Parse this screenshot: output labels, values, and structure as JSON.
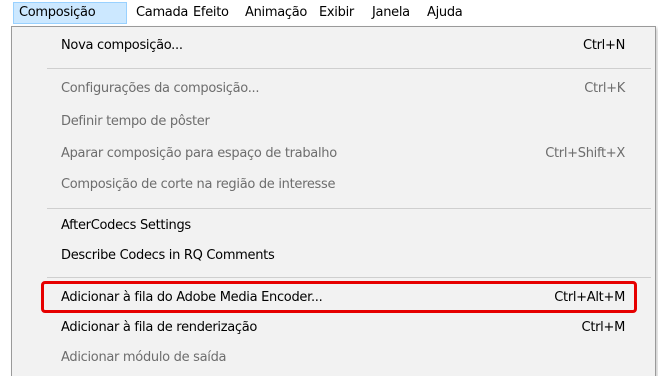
{
  "menubar": {
    "items": [
      {
        "label": "Composição",
        "active": true
      },
      {
        "label": "Camada"
      },
      {
        "label": "Efeito"
      },
      {
        "label": "Animação"
      },
      {
        "label": "Exibir"
      },
      {
        "label": "Janela"
      },
      {
        "label": "Ajuda"
      }
    ]
  },
  "dropdown": {
    "items": [
      {
        "label": "Nova composição...",
        "shortcut": "Ctrl+N",
        "enabled": true
      },
      {
        "label": "Configurações da composição...",
        "shortcut": "Ctrl+K",
        "enabled": false
      },
      {
        "label": "Definir tempo de pôster",
        "shortcut": "",
        "enabled": false
      },
      {
        "label": "Aparar composição para espaço de trabalho",
        "shortcut": "Ctrl+Shift+X",
        "enabled": false
      },
      {
        "label": "Composição de corte na região de interesse",
        "shortcut": "",
        "enabled": false
      },
      {
        "label": "AfterCodecs Settings",
        "shortcut": "",
        "enabled": true
      },
      {
        "label": "Describe Codecs in RQ Comments",
        "shortcut": "",
        "enabled": true
      },
      {
        "label": "Adicionar à fila do Adobe Media Encoder...",
        "shortcut": "Ctrl+Alt+M",
        "enabled": true,
        "highlighted": true
      },
      {
        "label": "Adicionar à fila de renderização",
        "shortcut": "Ctrl+M",
        "enabled": true
      },
      {
        "label": "Adicionar módulo de saída",
        "shortcut": "",
        "enabled": false
      }
    ]
  },
  "colors": {
    "active_menu_bg": "#cce8ff",
    "highlight_border": "#e60000",
    "disabled_text": "#6d6d6d",
    "menu_bg": "#f2f2f2"
  }
}
